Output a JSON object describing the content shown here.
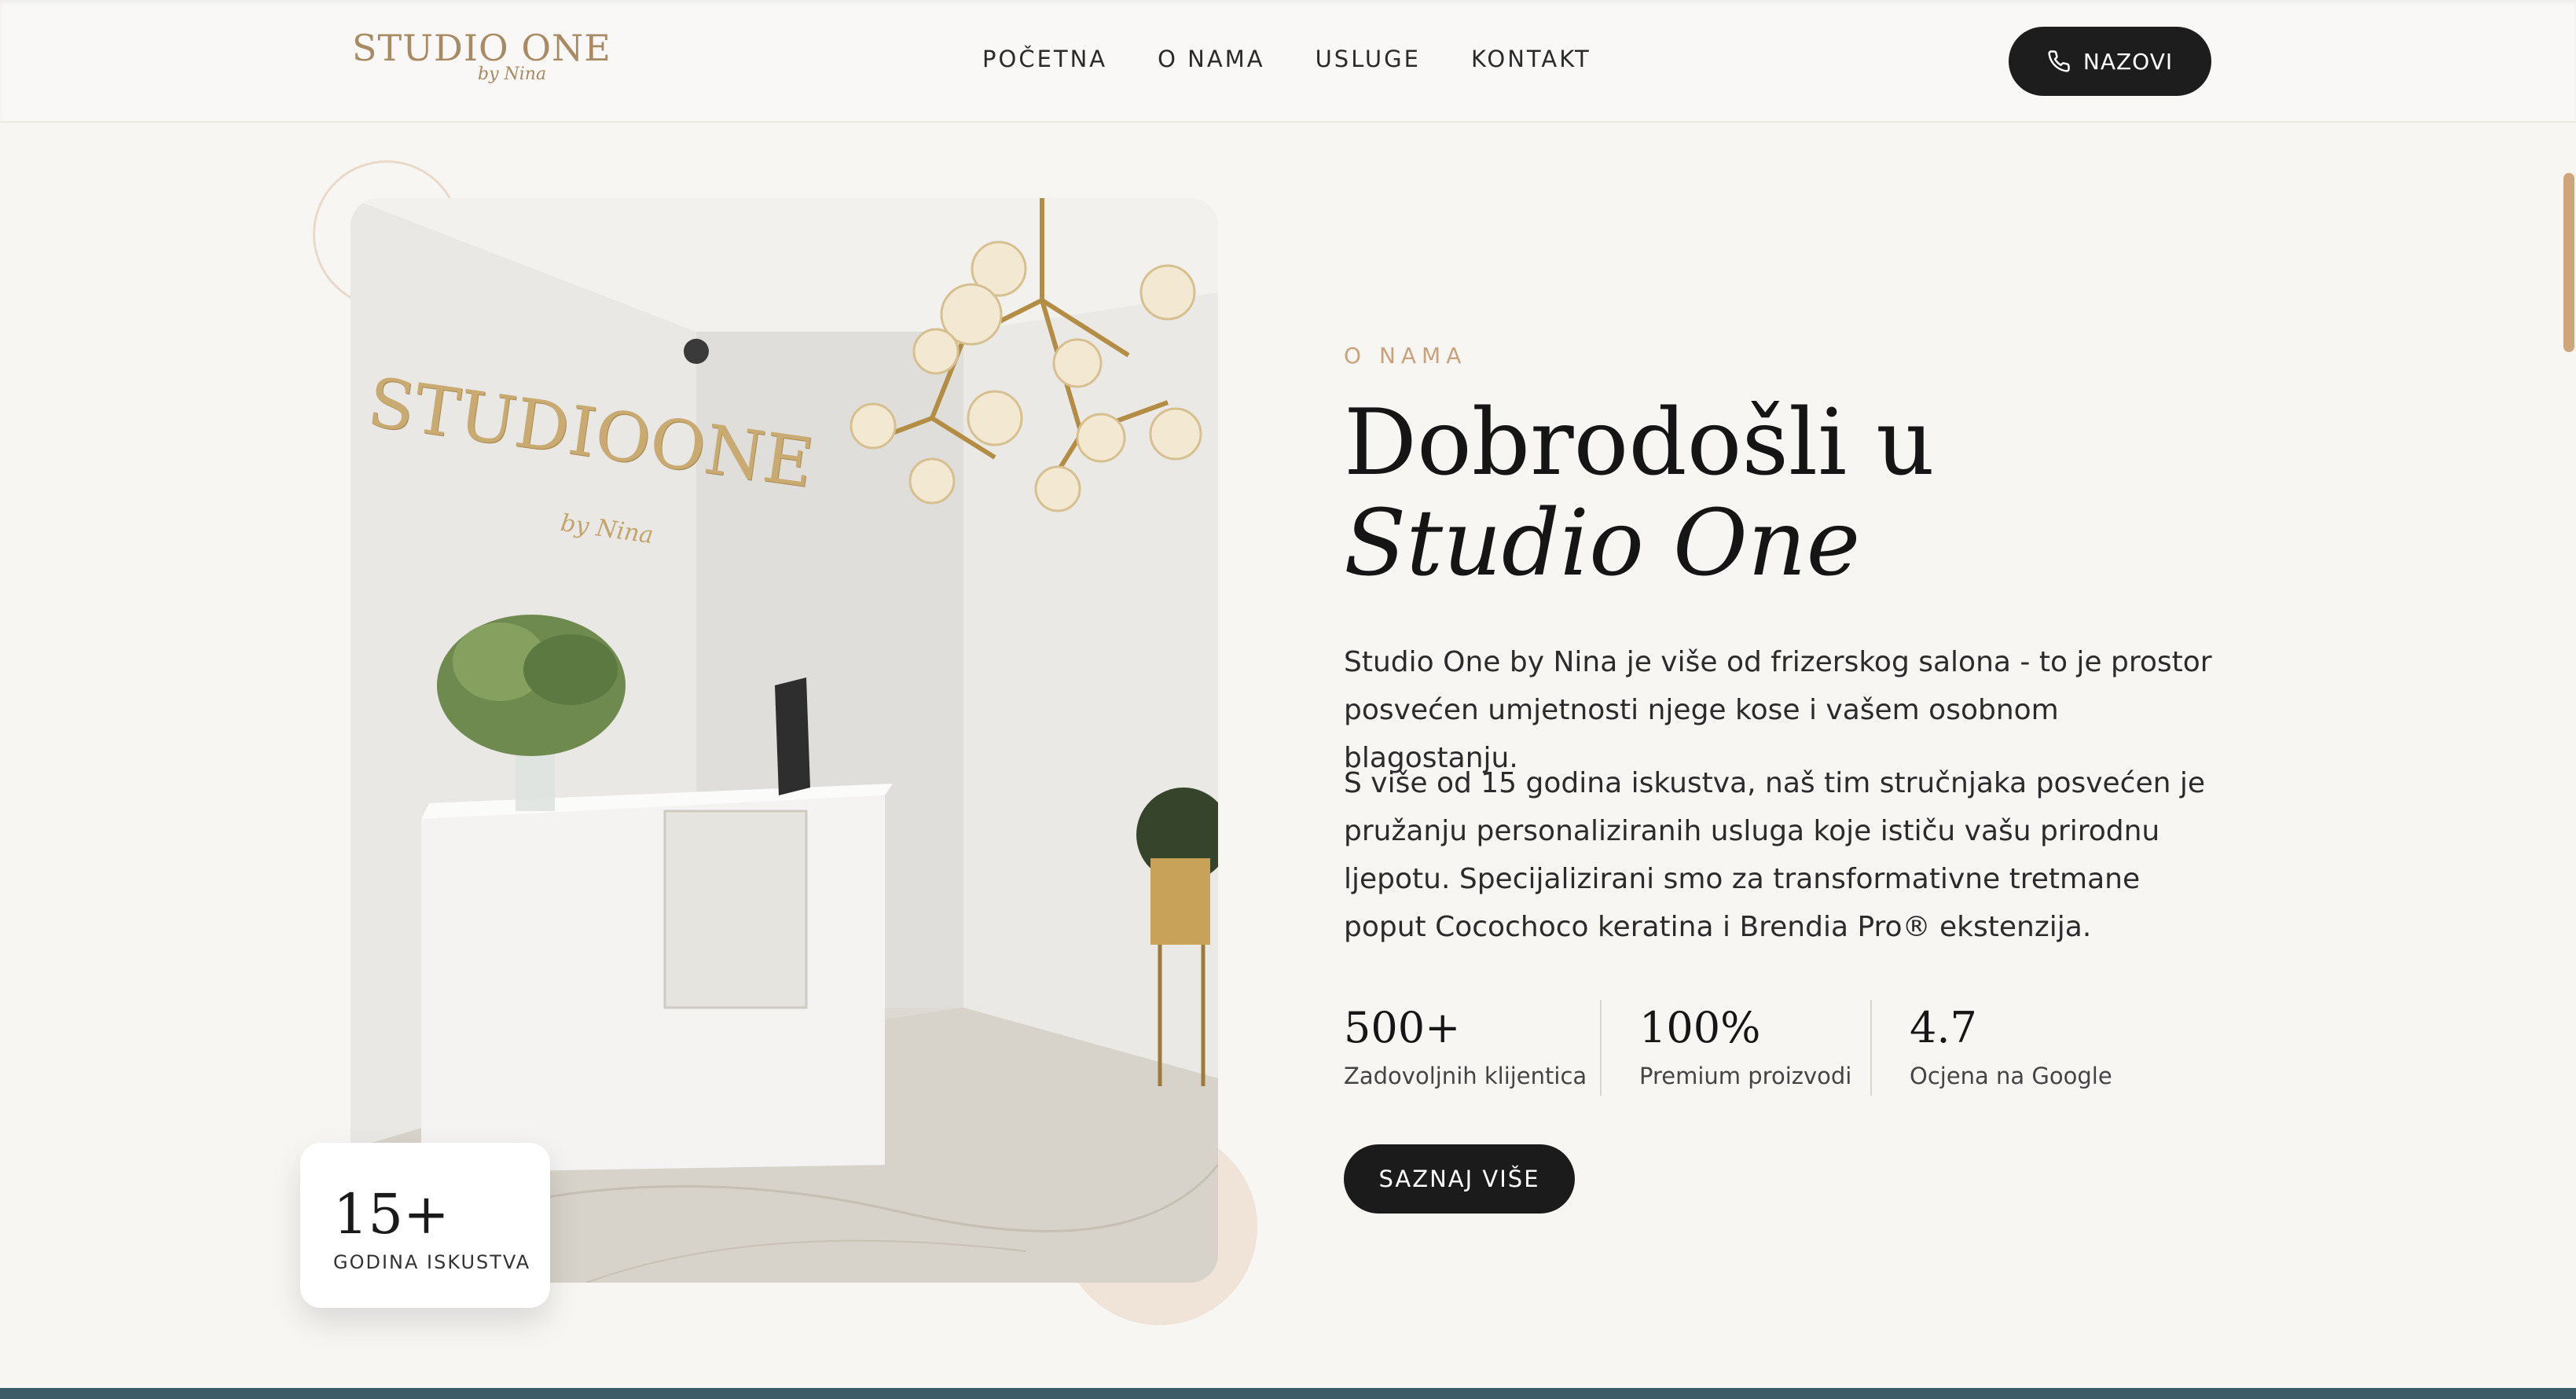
{
  "header": {
    "logo": {
      "main": "STUDIO ONE",
      "sub": "by Nina"
    },
    "nav": [
      "POČETNA",
      "O NAMA",
      "USLUGE",
      "KONTAKT"
    ],
    "call_label": "NAZOVI"
  },
  "photo": {
    "sign": "STUDIOONE",
    "sign_sub": "by Nina"
  },
  "experience": {
    "value": "15+",
    "label": "GODINA ISKUSTVA"
  },
  "about": {
    "eyebrow": "O NAMA",
    "title_plain": "Dobrodošli u ",
    "title_italic": "Studio One",
    "paragraph1": "Studio One by Nina je više od frizerskog salona - to je prostor posvećen umjetnosti njege kose i vašem osobnom blagostanju.",
    "paragraph2": "S više od 15 godina iskustva, naš tim stručnjaka posvećen je pružanju personaliziranih usluga koje ističu vašu prirodnu ljepotu. Specijalizirani smo za transformativne tretmane poput Cocochoco keratina i Brendia Pro® ekstenzija.",
    "stats": [
      {
        "value": "500+",
        "label": "Zadovoljnih klijentica"
      },
      {
        "value": "100%",
        "label": "Premium proizvodi"
      },
      {
        "value": "4.7",
        "label": "Ocjena na Google"
      }
    ],
    "cta": "SAZNAJ VIŠE"
  },
  "colors": {
    "accent": "#c9a27c",
    "dark": "#1b1b1b",
    "background": "#f8f6f3",
    "gold": "#a88a63"
  }
}
